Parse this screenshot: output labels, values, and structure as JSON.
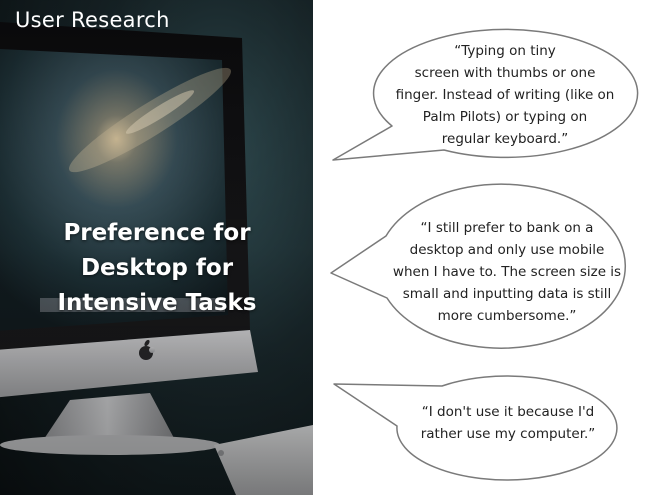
{
  "slide": {
    "section_label": "User Research",
    "headline_lines": [
      "Preference for",
      "Desktop for",
      "Intensive Tasks"
    ],
    "quotes": [
      {
        "lines": [
          "“Typing on tiny",
          "screen with thumbs or one",
          "finger. Instead of writing (like on",
          "Palm Pilots) or typing on",
          "regular keyboard.”"
        ]
      },
      {
        "lines": [
          "“I still prefer to bank on a",
          "desktop and only use mobile",
          "when I have to. The screen size is",
          "small and inputting data is still",
          "more cumbersome.”"
        ]
      },
      {
        "lines": [
          "“I don't use it because I'd",
          "rather use my computer.”"
        ]
      }
    ],
    "colors": {
      "bubble_stroke": "#7a7a7a",
      "bubble_fill": "#ffffff",
      "text": "#222222"
    }
  }
}
